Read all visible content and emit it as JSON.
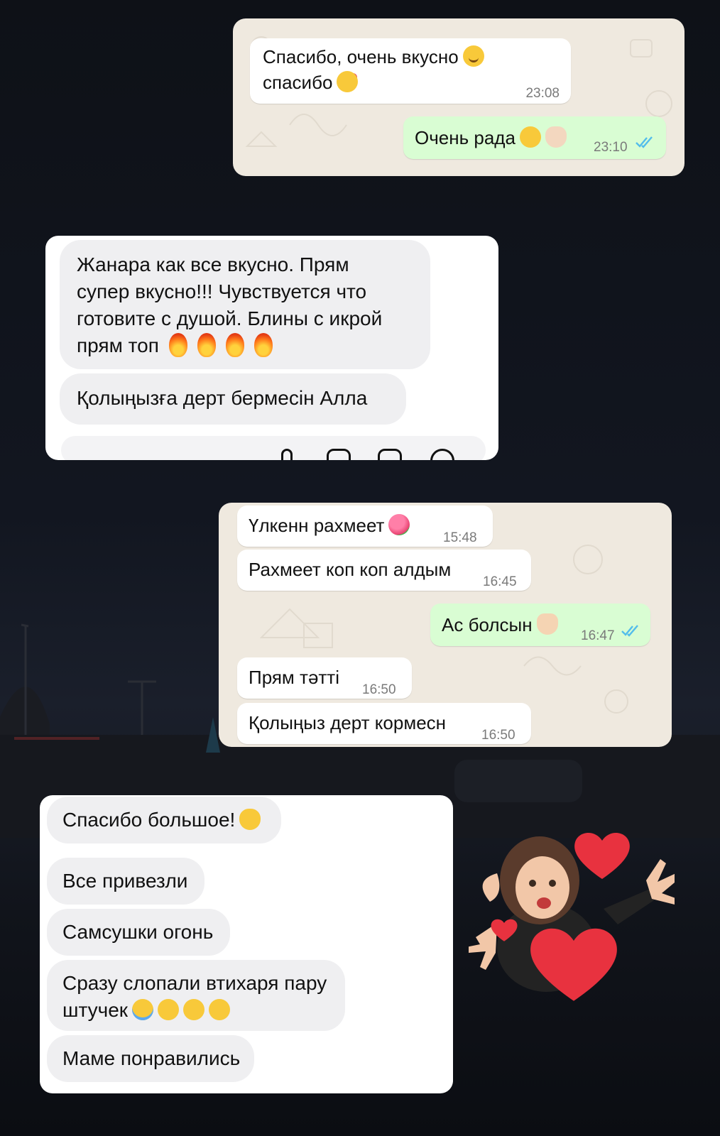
{
  "card1": {
    "messages": [
      {
        "line1": "Спасибо, очень вкусно",
        "line2": "спасибо",
        "time": "23:08",
        "direction": "in"
      },
      {
        "text": "Очень рада",
        "time": "23:10",
        "direction": "out",
        "status": "read"
      }
    ]
  },
  "card2": {
    "messages": [
      {
        "lines": [
          "Жанара как все вкусно. Прям",
          "супер вкусно!!! Чувствуется что",
          "готовите с душой. Блины с икрой",
          "прям топ"
        ]
      },
      {
        "text": "Қолыңызға дерт бермесін Алла"
      }
    ]
  },
  "card3": {
    "messages": [
      {
        "text": "Үлкенн рахмеет",
        "time": "15:48",
        "direction": "in"
      },
      {
        "text": "Рахмеет коп коп алдым",
        "time": "16:45",
        "direction": "in"
      },
      {
        "text": "Ас болсын",
        "time": "16:47",
        "direction": "out",
        "status": "read"
      },
      {
        "text": "Прям тәтті",
        "time": "16:50",
        "direction": "in"
      },
      {
        "text": "Қолыңыз дерт кормесн",
        "time": "16:50",
        "direction": "in"
      }
    ]
  },
  "card4": {
    "messages": [
      {
        "text": "Спасибо большое!"
      },
      {
        "text": "Все привезли"
      },
      {
        "text": "Самсушки огонь"
      },
      {
        "line1": "Сразу слопали втихаря пару",
        "line2": "штучек"
      },
      {
        "text": "Маме понравились"
      }
    ]
  },
  "colors": {
    "wa_background": "#efe9df",
    "wa_outgoing": "#d9fdd3",
    "wa_incoming": "#ffffff",
    "read_ticks": "#53bdeb",
    "ig_bubble": "#efeff1",
    "heart": "#e8323f"
  },
  "icons": [
    "smiling-emoji",
    "smiling-face-with-hearts-emoji",
    "pleading-face-emoji",
    "ok-hand-emoji",
    "fire-emoji",
    "bouquet-emoji",
    "raising-hands-emoji",
    "heart-eyes-cat-emoji",
    "tears-of-joy-emoji",
    "yum-emoji",
    "memoji-sticker",
    "heart-icon",
    "read-receipt-icon"
  ]
}
